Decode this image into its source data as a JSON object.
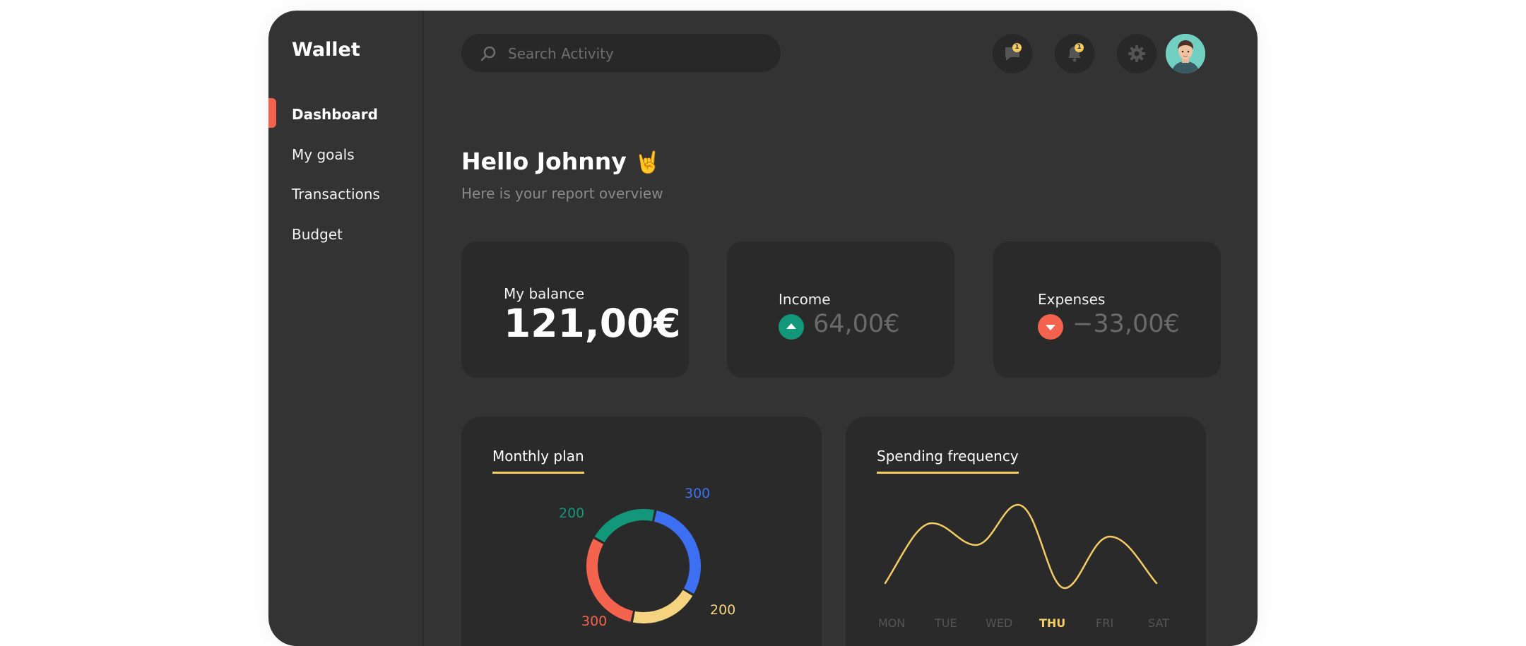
{
  "app": {
    "title": "Wallet"
  },
  "sidebar": {
    "items": [
      {
        "label": "Dashboard",
        "active": true
      },
      {
        "label": "My goals"
      },
      {
        "label": "Transactions"
      },
      {
        "label": "Budget"
      }
    ]
  },
  "search": {
    "placeholder": "Search Activity",
    "value": ""
  },
  "header": {
    "messages": {
      "icon": "message-icon",
      "badge": "1"
    },
    "notifications": {
      "icon": "bell-icon",
      "badge": "1"
    },
    "settings": {
      "icon": "gear-icon"
    }
  },
  "greeting": {
    "title": "Hello Johnny",
    "emoji": "🤘",
    "subtitle": "Here is your report overview"
  },
  "cards": {
    "balance": {
      "label": "My balance",
      "value": "121,00€"
    },
    "income": {
      "label": "Income",
      "value": "64,00€",
      "icon": "arrow-up-icon"
    },
    "expenses": {
      "label": "Expenses",
      "value": "−33,00€",
      "icon": "arrow-down-icon"
    }
  },
  "monthly_plan": {
    "title": "Monthly plan",
    "chart_data": {
      "type": "pie",
      "values": [
        300,
        200,
        300,
        200
      ],
      "labels": [
        "300",
        "200",
        "300",
        "200"
      ],
      "colors": [
        "#3d6ff2",
        "#f5d37f",
        "#f4634d",
        "#12977a"
      ]
    }
  },
  "spending_frequency": {
    "title": "Spending frequency",
    "chart_data": {
      "type": "line",
      "categories": [
        "MON",
        "TUE",
        "WED",
        "THU",
        "FRI",
        "SAT"
      ],
      "active_category": "THU",
      "color": "#f5cc63"
    }
  },
  "colors": {
    "accent": "#f4634d",
    "income": "#12977a",
    "expense": "#f4634d",
    "highlight": "#f5cc63"
  }
}
